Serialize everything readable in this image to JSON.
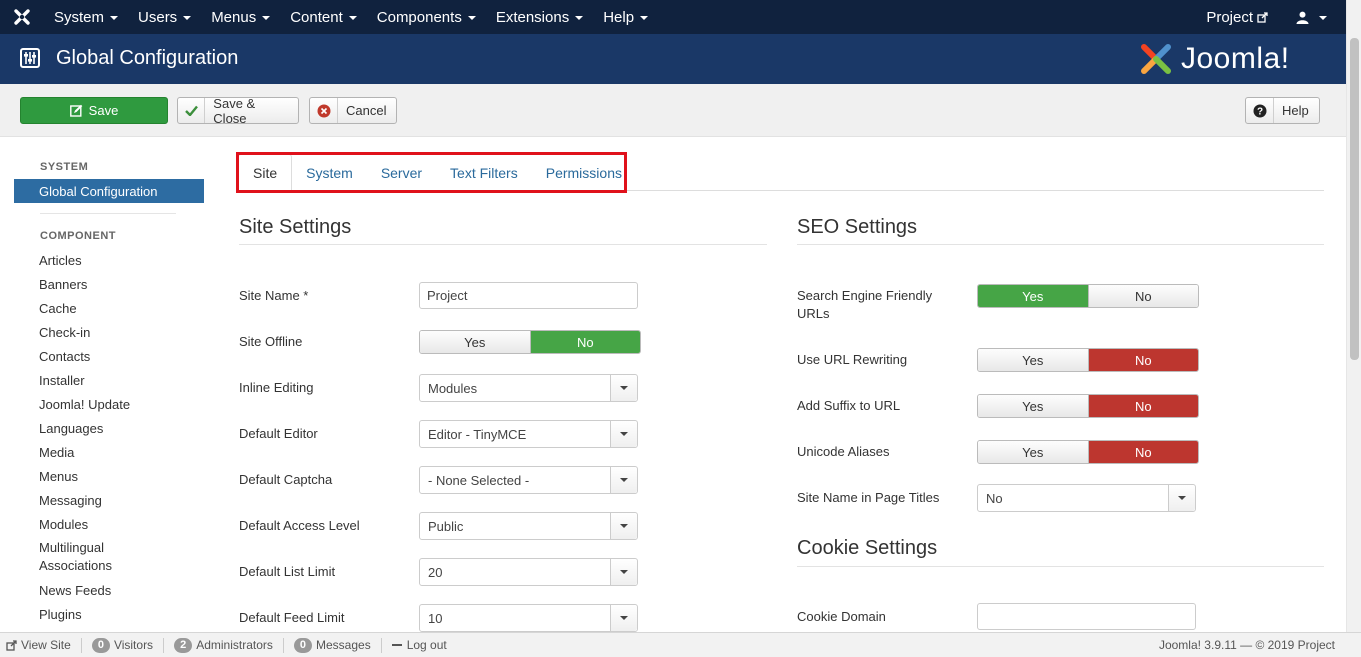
{
  "topnav": {
    "menu": [
      "System",
      "Users",
      "Menus",
      "Content",
      "Components",
      "Extensions",
      "Help"
    ],
    "project_link": "Project"
  },
  "header": {
    "title": "Global Configuration",
    "brand": "Joomla!"
  },
  "toolbar": {
    "save": "Save",
    "save_close": "Save & Close",
    "cancel": "Cancel",
    "help": "Help"
  },
  "sidebar": {
    "system_heading": "SYSTEM",
    "active_item": "Global Configuration",
    "component_heading": "COMPONENT",
    "items": [
      "Articles",
      "Banners",
      "Cache",
      "Check-in",
      "Contacts",
      "Installer",
      "Joomla! Update",
      "Languages",
      "Media",
      "Menus",
      "Messaging",
      "Modules"
    ],
    "multi_a": "Multilingual",
    "multi_b": "Associations",
    "items2": [
      "News Feeds",
      "Plugins"
    ]
  },
  "tabs": [
    "Site",
    "System",
    "Server",
    "Text Filters",
    "Permissions"
  ],
  "site_settings": {
    "title": "Site Settings",
    "site_name_label": "Site Name *",
    "site_name_value": "Project",
    "site_offline_label": "Site Offline",
    "inline_editing_label": "Inline Editing",
    "inline_editing_value": "Modules",
    "default_editor_label": "Default Editor",
    "default_editor_value": "Editor - TinyMCE",
    "default_captcha_label": "Default Captcha",
    "default_captcha_value": "- None Selected -",
    "access_level_label": "Default Access Level",
    "access_level_value": "Public",
    "list_limit_label": "Default List Limit",
    "list_limit_value": "20",
    "feed_limit_label": "Default Feed Limit",
    "feed_limit_value": "10"
  },
  "seo_settings": {
    "title": "SEO Settings",
    "sef_label_1": "Search Engine Friendly",
    "sef_label_2": "URLs",
    "rewrite_label": "Use URL Rewriting",
    "suffix_label": "Add Suffix to URL",
    "unicode_label": "Unicode Aliases",
    "pagetitles_label": "Site Name in Page Titles",
    "pagetitles_value": "No"
  },
  "cookie_settings": {
    "title": "Cookie Settings",
    "domain_label": "Cookie Domain"
  },
  "toggle": {
    "yes": "Yes",
    "no": "No"
  },
  "footer": {
    "view_site": "View Site",
    "visitors_count": "0",
    "visitors": "Visitors",
    "admins_count": "2",
    "admins": "Administrators",
    "messages_count": "0",
    "messages": "Messages",
    "logout": "Log out",
    "version": "Joomla! 3.9.11  —  © 2019 Project"
  },
  "colors": {
    "nav": "#10223e",
    "header": "#1a3867",
    "save_green": "#2f9a3f",
    "toggle_green": "#46a546",
    "toggle_red": "#bd362f",
    "active_blue": "#2d6ca2",
    "highlight": "#e0111b"
  }
}
